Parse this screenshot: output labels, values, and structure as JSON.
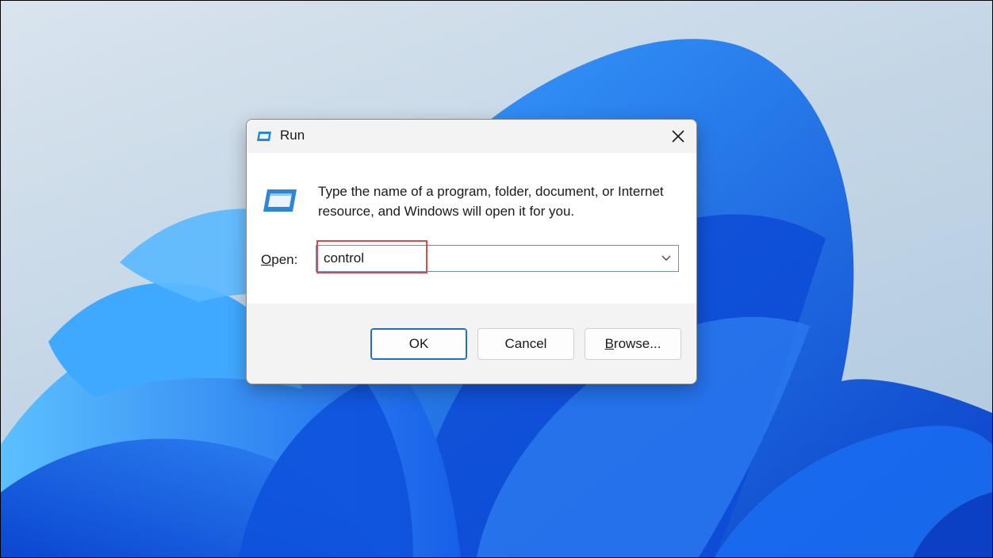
{
  "dialog": {
    "title": "Run",
    "description": "Type the name of a program, folder, document, or Internet resource, and Windows will open it for you.",
    "open_label": "Open:",
    "open_value": "control",
    "buttons": {
      "ok": "OK",
      "cancel": "Cancel",
      "browse_underlined": "B",
      "browse_rest": "rowse..."
    }
  },
  "icons": {
    "title": "run-icon",
    "body": "run-icon",
    "close": "close-icon",
    "dropdown": "chevron-down-icon"
  },
  "colors": {
    "accent": "#1f6fc4",
    "highlight_box": "#e04848",
    "wallpaper_blue": "#1565e0"
  }
}
